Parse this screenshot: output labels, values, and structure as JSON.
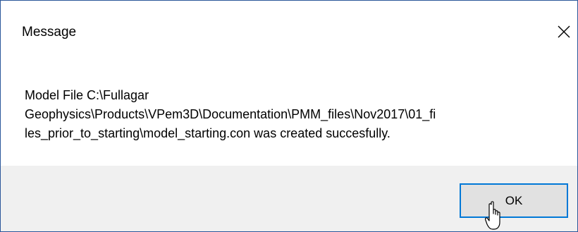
{
  "dialog": {
    "title": "Message",
    "close_icon": "close-icon",
    "message": "Model File C:\\Fullagar\nGeophysics\\Products\\VPem3D\\Documentation\\PMM_files\\Nov2017\\01_fi\nles_prior_to_starting\\model_starting.con was created succesfully.",
    "ok_label": "OK"
  },
  "colors": {
    "window_border": "#2b579a",
    "button_bar_background": "#f0f0f0",
    "button_focus_border": "#0078d7",
    "button_background": "#e1e1e1"
  },
  "cursor": {
    "icon": "hand-pointer-icon"
  }
}
